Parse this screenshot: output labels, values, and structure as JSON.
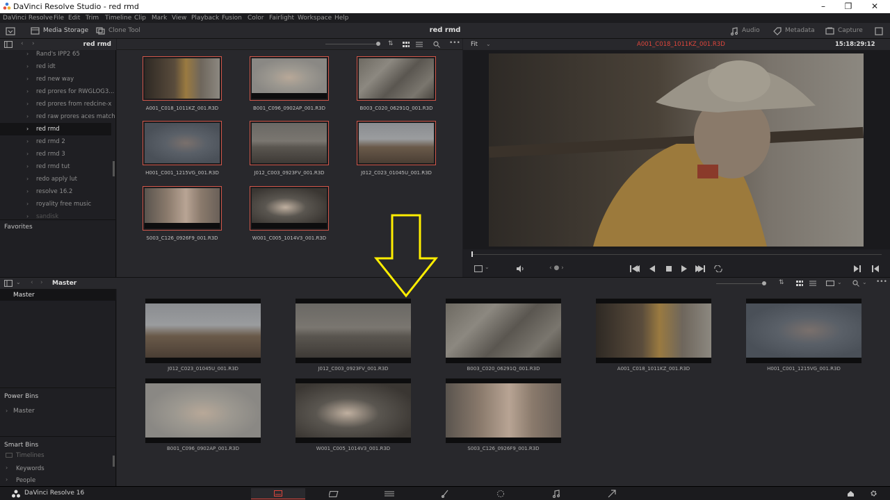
{
  "window": {
    "title": "DaVinci Resolve Studio - red rmd",
    "controls": [
      "–",
      "❐",
      "✕"
    ]
  },
  "menu": [
    "DaVinci Resolve",
    "File",
    "Edit",
    "Trim",
    "Timeline",
    "Clip",
    "Mark",
    "View",
    "Playback",
    "Fusion",
    "Color",
    "Fairlight",
    "Workspace",
    "Help"
  ],
  "toolbar": {
    "media_storage": "Media Storage",
    "clone_tool": "Clone Tool",
    "center_title": "red rmd",
    "audio": "Audio",
    "metadata": "Metadata",
    "capture": "Capture"
  },
  "storage_panel": {
    "path_title": "red rmd",
    "items": [
      {
        "label": "Rand's IPP2 65",
        "selected": false
      },
      {
        "label": "red idt",
        "selected": false
      },
      {
        "label": "red new way",
        "selected": false
      },
      {
        "label": "red prores for RWGLOG3...",
        "selected": false
      },
      {
        "label": "red prores from redcine-x",
        "selected": false
      },
      {
        "label": "red raw prores aces match",
        "selected": false
      },
      {
        "label": "red rmd",
        "selected": true
      },
      {
        "label": "red rmd 2",
        "selected": false
      },
      {
        "label": "red rmd 3",
        "selected": false
      },
      {
        "label": "red rmd tut",
        "selected": false
      },
      {
        "label": "redo apply lut",
        "selected": false
      },
      {
        "label": "resolve 16.2",
        "selected": false
      },
      {
        "label": "royality free music",
        "selected": false
      },
      {
        "label": "sandisk",
        "selected": false
      }
    ],
    "favorites_label": "Favorites"
  },
  "storage_clips": [
    {
      "name": "A001_C018_1011KZ_001.R3D"
    },
    {
      "name": "B001_C096_0902AP_001.R3D"
    },
    {
      "name": "B003_C020_06291Q_001.R3D"
    },
    {
      "name": "H001_C001_1215VG_001.R3D"
    },
    {
      "name": "J012_C003_0923FV_001.R3D"
    },
    {
      "name": "J012_C023_01045U_001.R3D"
    },
    {
      "name": "S003_C126_0926F9_001.R3D"
    },
    {
      "name": "W001_C005_1014V3_001.R3D"
    }
  ],
  "viewer": {
    "zoom": "Fit",
    "clip_name": "A001_C018_1011KZ_001.R3D",
    "timecode": "15:18:29:12",
    "clip_name_color": "#e0463c"
  },
  "media_pool": {
    "bin_title": "Master",
    "master_label": "Master",
    "power_bins_label": "Power Bins",
    "power_bins_items": [
      "Master"
    ],
    "smart_bins_label": "Smart Bins",
    "smart_bins_items": [
      "Timelines",
      "Keywords",
      "People"
    ],
    "clips": [
      {
        "name": "J012_C023_01045U_001.R3D"
      },
      {
        "name": "J012_C003_0923FV_001.R3D"
      },
      {
        "name": "B003_C020_06291Q_001.R3D"
      },
      {
        "name": "A001_C018_1011KZ_001.R3D"
      },
      {
        "name": "H001_C001_1215VG_001.R3D"
      },
      {
        "name": "B001_C096_0902AP_001.R3D"
      },
      {
        "name": "W001_C005_1014V3_001.R3D"
      },
      {
        "name": "S003_C126_0926F9_001.R3D"
      }
    ]
  },
  "bottom": {
    "app_name": "DaVinci Resolve 16",
    "pages": [
      "media-page-icon",
      "cut-page-icon",
      "edit-page-icon",
      "fusion-page-icon",
      "color-page-icon",
      "fairlight-page-icon",
      "deliver-page-icon"
    ]
  },
  "annotation": {
    "arrow_color": "#ffee00"
  }
}
